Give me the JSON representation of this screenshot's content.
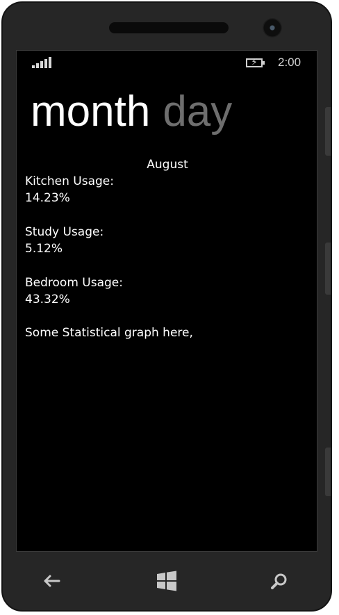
{
  "status_bar": {
    "signal_icon": "signal-strength-icon",
    "battery_icon": "battery-charging-icon",
    "time": "2:00"
  },
  "pivot": {
    "items": [
      {
        "label": "month",
        "active": true
      },
      {
        "label": "day",
        "active": false
      }
    ]
  },
  "content": {
    "month": "August",
    "stats": [
      {
        "label": "Kitchen Usage:",
        "value": "14.23%"
      },
      {
        "label": "Study Usage:",
        "value": "5.12%"
      },
      {
        "label": "Bedroom Usage:",
        "value": "43.32%"
      }
    ],
    "note": "Some Statistical graph here,"
  },
  "hardware_buttons": {
    "back_icon": "back-arrow-icon",
    "start_icon": "windows-logo-icon",
    "search_icon": "search-icon"
  },
  "colors": {
    "background": "#000000",
    "text": "#ffffff",
    "inactive_pivot": "#6e6e6e",
    "bezel": "#262626"
  }
}
